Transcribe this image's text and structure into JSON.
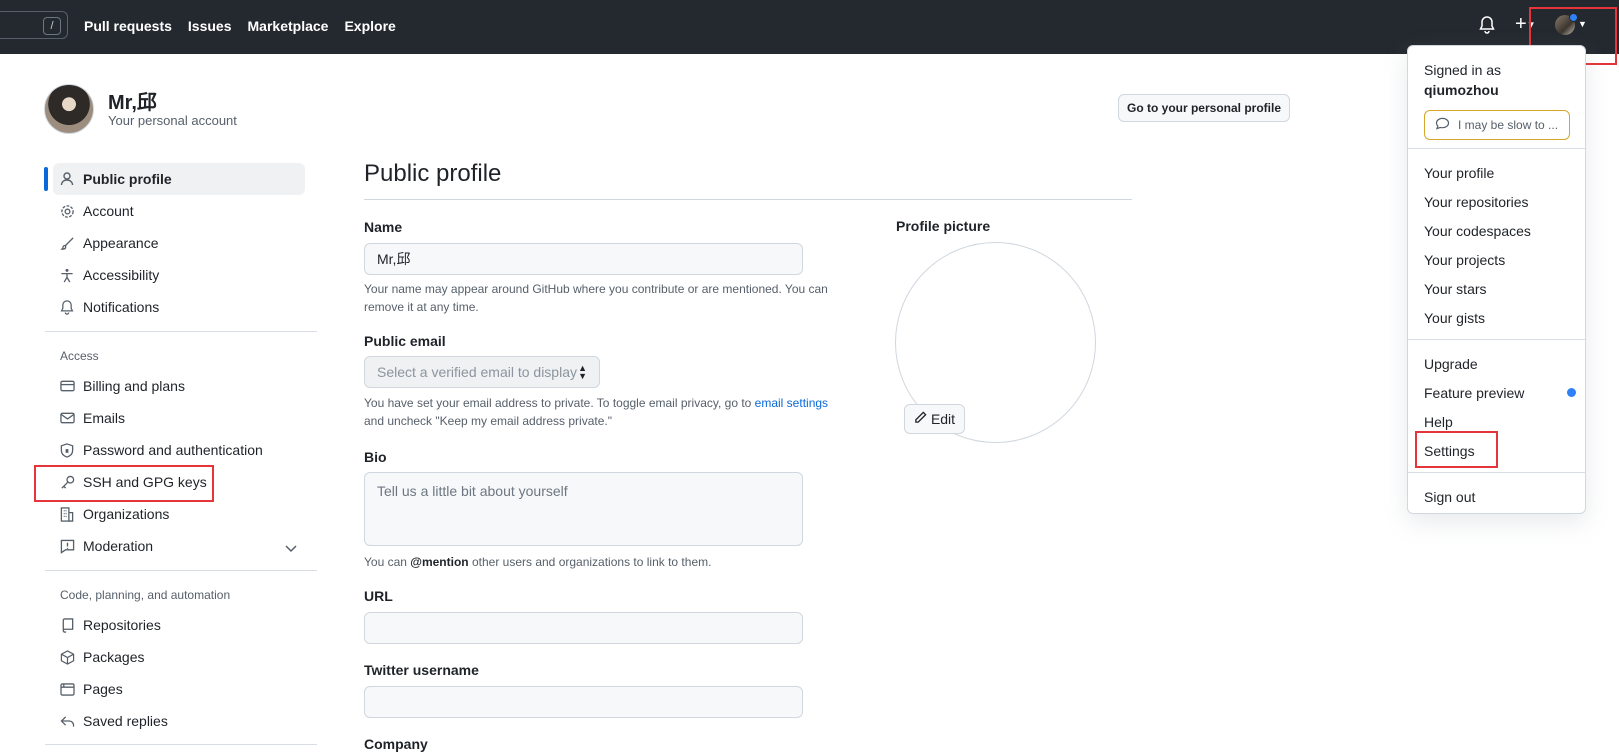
{
  "header": {
    "search_shortcut": "/",
    "nav": [
      "Pull requests",
      "Issues",
      "Marketplace",
      "Explore"
    ]
  },
  "user": {
    "display_name": "Mr,邱",
    "subtitle": "Your personal account",
    "goto_profile": "Go to your personal profile"
  },
  "sidebar": {
    "items": [
      {
        "label": "Public profile",
        "icon": "person-icon"
      },
      {
        "label": "Account",
        "icon": "gear-icon"
      },
      {
        "label": "Appearance",
        "icon": "paintbrush-icon"
      },
      {
        "label": "Accessibility",
        "icon": "accessibility-icon"
      },
      {
        "label": "Notifications",
        "icon": "bell-icon"
      }
    ],
    "access_heading": "Access",
    "access_items": [
      {
        "label": "Billing and plans",
        "icon": "credit-card-icon"
      },
      {
        "label": "Emails",
        "icon": "mail-icon"
      },
      {
        "label": "Password and authentication",
        "icon": "shield-lock-icon"
      },
      {
        "label": "SSH and GPG keys",
        "icon": "key-icon"
      },
      {
        "label": "Organizations",
        "icon": "organization-icon"
      },
      {
        "label": "Moderation",
        "icon": "report-icon"
      }
    ],
    "code_heading": "Code, planning, and automation",
    "code_items": [
      {
        "label": "Repositories",
        "icon": "repo-icon"
      },
      {
        "label": "Packages",
        "icon": "package-icon"
      },
      {
        "label": "Pages",
        "icon": "browser-icon"
      },
      {
        "label": "Saved replies",
        "icon": "reply-icon"
      }
    ]
  },
  "main": {
    "title": "Public profile",
    "name_label": "Name",
    "name_value": "Mr,邱",
    "name_note": "Your name may appear around GitHub where you contribute or are mentioned. You can remove it at any time.",
    "email_label": "Public email",
    "email_select": "Select a verified email to display",
    "email_note_1": "You have set your email address to private. To toggle email privacy, go to ",
    "email_note_link": "email settings",
    "email_note_2": " and uncheck \"Keep my email address private.\"",
    "bio_label": "Bio",
    "bio_placeholder": "Tell us a little bit about yourself",
    "bio_note_1": "You can ",
    "bio_note_mention": "@mention",
    "bio_note_2": " other users and organizations to link to them.",
    "url_label": "URL",
    "twitter_label": "Twitter username",
    "company_label": "Company",
    "picture_label": "Profile picture",
    "edit_label": "Edit"
  },
  "menu": {
    "signed_in_as": "Signed in as",
    "username": "qiumozhou",
    "status": "I may be slow to ...",
    "group1": [
      "Your profile",
      "Your repositories",
      "Your codespaces",
      "Your projects",
      "Your stars",
      "Your gists"
    ],
    "group2": [
      "Upgrade",
      "Feature preview",
      "Help",
      "Settings"
    ],
    "sign_out": "Sign out"
  },
  "colors": {
    "accent": "#0969da",
    "highlight": "#e5343a",
    "header_bg": "#24292f"
  }
}
